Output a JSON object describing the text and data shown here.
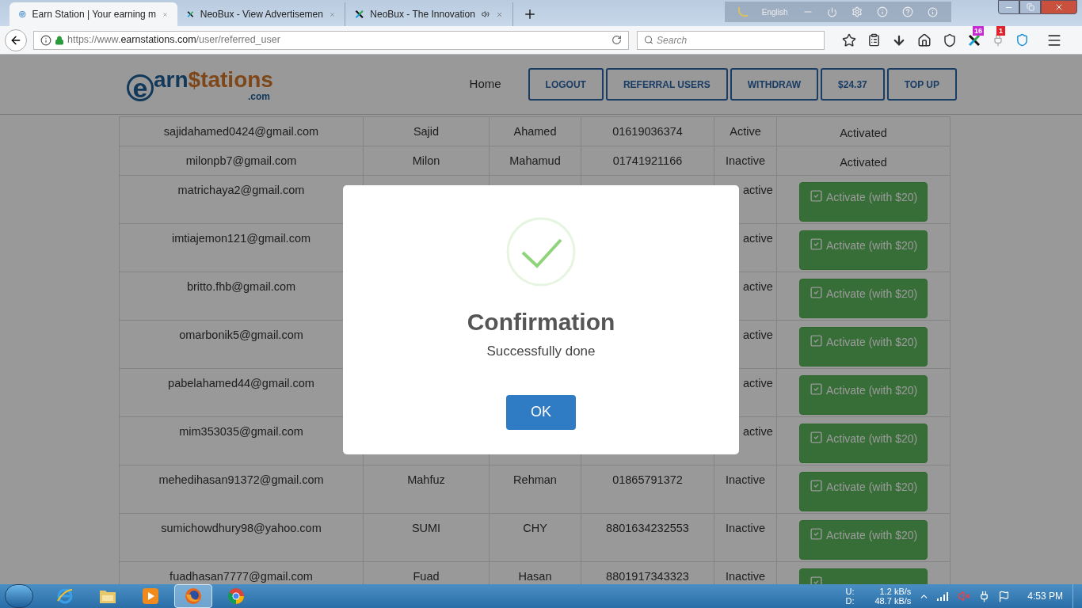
{
  "browser": {
    "tabs": [
      {
        "title": "Earn Station | Your earning m",
        "selected": true,
        "kind": "site"
      },
      {
        "title": "NeoBux - View Advertisemen",
        "selected": false,
        "kind": "neobux"
      },
      {
        "title": "NeoBux - The Innovation",
        "selected": false,
        "kind": "neobux",
        "audio": true
      }
    ],
    "language": "English",
    "url": {
      "scheme": "https://www.",
      "domain": "earnstations.com",
      "path": "/user/referred_user"
    },
    "search": {
      "placeholder": "Search"
    },
    "badges": [
      "16",
      "1"
    ]
  },
  "site": {
    "logo": {
      "mark": "e",
      "word_start": "arn",
      "word_end": "$tations",
      "domain": ".com"
    },
    "nav": {
      "home": "Home",
      "buttons": [
        "LOGOUT",
        "REFERRAL USERS",
        "WITHDRAW",
        "$24.37",
        "TOP UP"
      ]
    }
  },
  "table": {
    "rows": [
      {
        "email": "sajidahamed0424@gmail.com",
        "first": "Sajid",
        "last": "Ahamed",
        "phone": "01619036374",
        "status": "Active",
        "action": {
          "kind": "text",
          "label": "Activated"
        }
      },
      {
        "email": "milonpb7@gmail.com",
        "first": "Milon",
        "last": "Mahamud",
        "phone": "01741921166",
        "status": "Inactive",
        "action": {
          "kind": "text",
          "label": "Activated"
        }
      },
      {
        "email": "matrichaya2@gmail.com",
        "status": "active",
        "action": {
          "kind": "button",
          "label": "Activate (with $20)"
        }
      },
      {
        "email": "imtiajemon121@gmail.com",
        "status": "active",
        "action": {
          "kind": "button",
          "label": "Activate (with $20)"
        }
      },
      {
        "email": "britto.fhb@gmail.com",
        "status": "active",
        "action": {
          "kind": "button",
          "label": "Activate (with $20)"
        }
      },
      {
        "email": "omarbonik5@gmail.com",
        "status": "active",
        "action": {
          "kind": "button",
          "label": "Activate (with $20)"
        }
      },
      {
        "email": "pabelahamed44@gmail.com",
        "status": "active",
        "action": {
          "kind": "button",
          "label": "Activate (with $20)"
        }
      },
      {
        "email": "mim353035@gmail.com",
        "status": "active",
        "action": {
          "kind": "button",
          "label": "Activate (with $20)"
        }
      },
      {
        "email": "mehedihasan91372@gmail.com",
        "first": "Mahfuz",
        "last": "Rehman",
        "phone": "01865791372",
        "status": "Inactive",
        "action": {
          "kind": "button",
          "label": "Activate (with $20)"
        }
      },
      {
        "email": "sumichowdhury98@yahoo.com",
        "first": "SUMI",
        "last": "CHY",
        "phone": "8801634232553",
        "status": "Inactive",
        "action": {
          "kind": "button",
          "label": "Activate (with $20)"
        }
      },
      {
        "email": "fuadhasan7777@gmail.com",
        "first": "Fuad",
        "last": "Hasan",
        "phone": "8801917343323",
        "status": "Inactive",
        "action": {
          "kind": "button"
        }
      }
    ]
  },
  "dialog": {
    "title": "Confirmation",
    "message": "Successfully done",
    "button": "OK"
  },
  "taskbar": {
    "upload_label": "U:",
    "upload": "1.2 kB/s",
    "download_label": "D:",
    "download": "48.7 kB/s",
    "clock": "4:53 PM",
    "apps": [
      {
        "kind": "ie",
        "selected": false
      },
      {
        "kind": "explorer",
        "selected": false
      },
      {
        "kind": "media",
        "selected": false
      },
      {
        "kind": "firefox",
        "selected": true
      },
      {
        "kind": "chrome",
        "selected": false
      }
    ]
  }
}
